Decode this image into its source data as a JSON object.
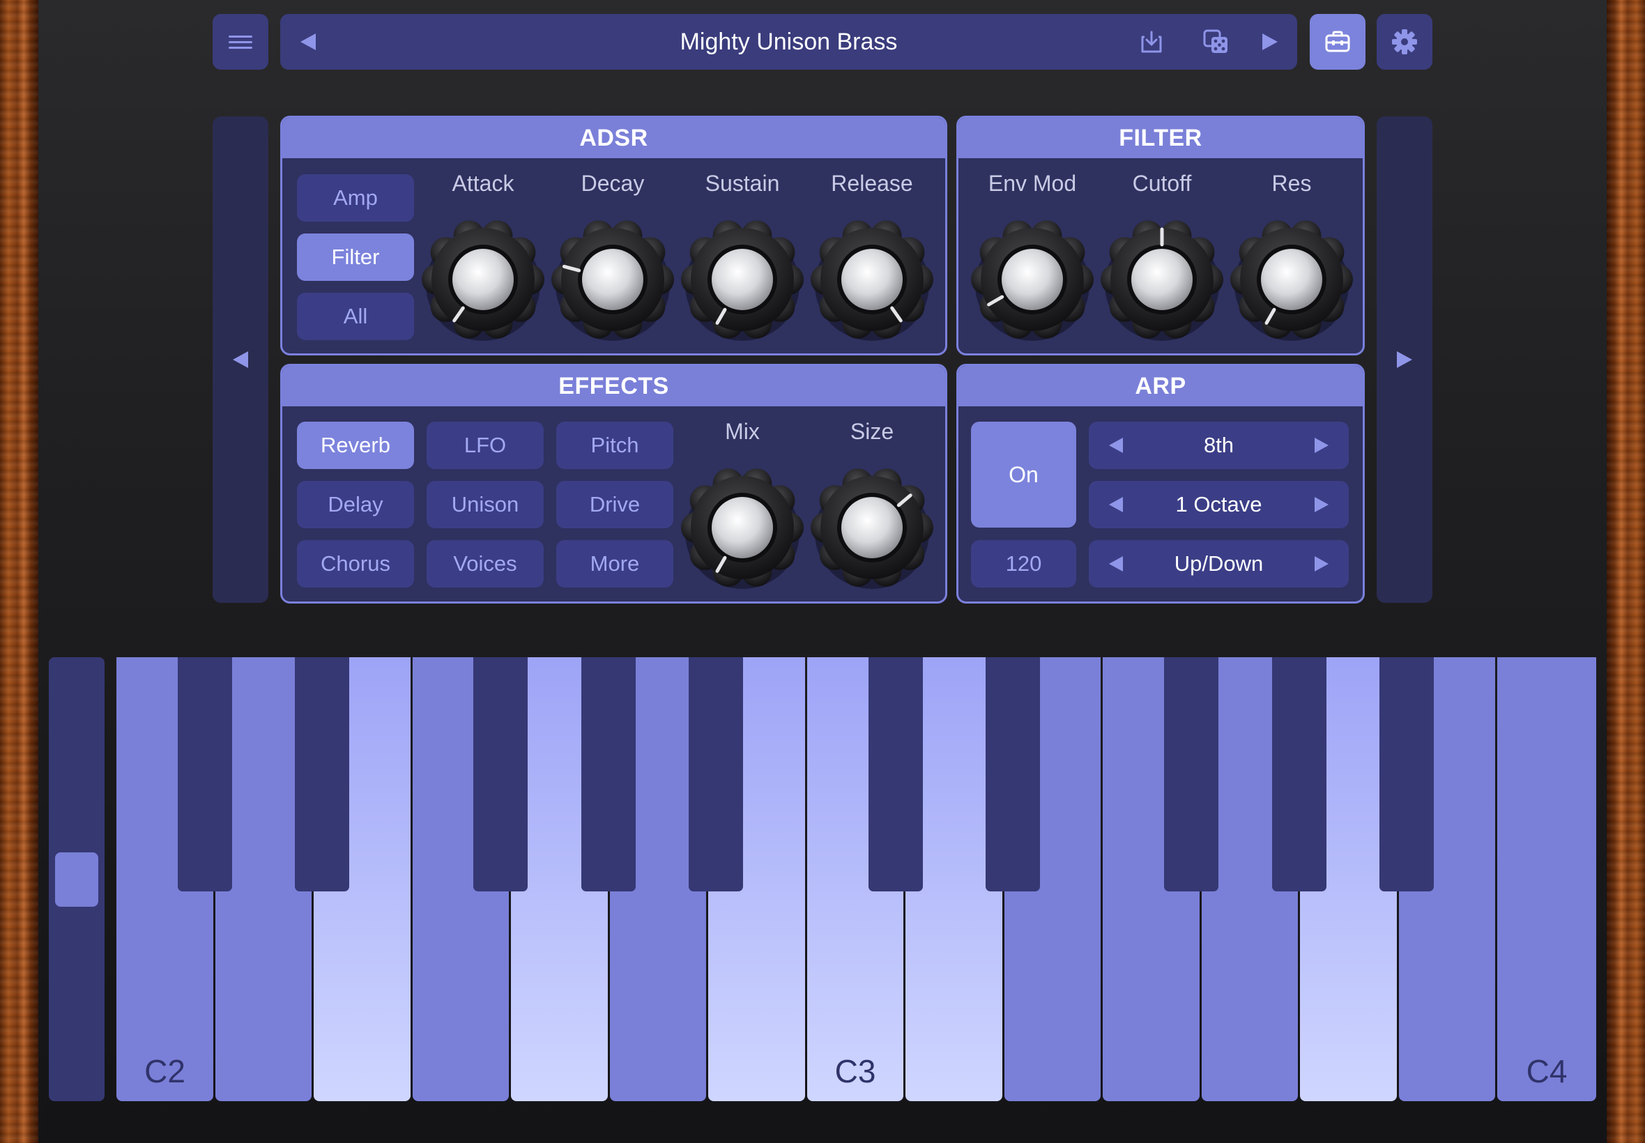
{
  "app": {
    "preset_name": "Mighty Unison Brass"
  },
  "topbar": {
    "menu_icon": "hamburger-menu-icon",
    "prev_icon": "triangle-left-icon",
    "save_icon": "download-tray-icon",
    "random_icon": "dice-icon",
    "next_icon": "triangle-right-icon",
    "toolbox_icon": "toolbox-icon",
    "settings_icon": "gear-icon"
  },
  "adsr": {
    "title": "ADSR",
    "targets": [
      "Amp",
      "Filter",
      "All"
    ],
    "selected_target": "Filter",
    "knobs": [
      {
        "label": "Attack"
      },
      {
        "label": "Decay"
      },
      {
        "label": "Sustain"
      },
      {
        "label": "Release"
      }
    ]
  },
  "filter": {
    "title": "FILTER",
    "knobs": [
      {
        "label": "Env Mod"
      },
      {
        "label": "Cutoff"
      },
      {
        "label": "Res"
      }
    ]
  },
  "effects": {
    "title": "EFFECTS",
    "buttons": [
      "Reverb",
      "LFO",
      "Pitch",
      "Delay",
      "Unison",
      "Drive",
      "Chorus",
      "Voices",
      "More"
    ],
    "selected": "Reverb",
    "knobs": [
      {
        "label": "Mix"
      },
      {
        "label": "Size"
      }
    ]
  },
  "arp": {
    "title": "ARP",
    "toggle_label": "On",
    "bpm": "120",
    "rate": "8th",
    "range": "1 Octave",
    "mode": "Up/Down"
  },
  "keyboard": {
    "labels": {
      "c2": "C2",
      "c3": "C3",
      "c4": "C4"
    },
    "pressed_keys": [
      "E2",
      "G2",
      "B2",
      "C3",
      "D3",
      "A3"
    ]
  },
  "colors": {
    "accent": "#7c83dc",
    "button": "#3b3e86",
    "panel": "#2f315f"
  }
}
